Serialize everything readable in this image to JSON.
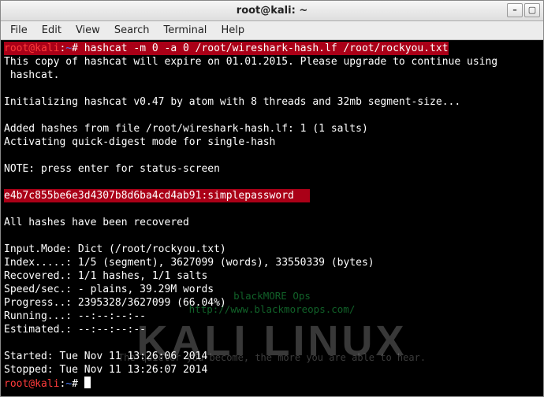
{
  "titlebar": {
    "title": "root@kali: ~",
    "min_icon": "–",
    "max_icon": "▢"
  },
  "menubar": {
    "file": "File",
    "edit": "Edit",
    "view": "View",
    "search": "Search",
    "terminal": "Terminal",
    "help": "Help"
  },
  "prompt": {
    "userhost": "root@kali",
    "colon": ":",
    "path": "~",
    "hash": "#"
  },
  "command": "hashcat -m 0 -a 0 /root/wireshark-hash.lf /root/rockyou.txt",
  "output": {
    "l1": "This copy of hashcat will expire on 01.01.2015. Please upgrade to continue using",
    "l2": " hashcat.",
    "blank_a": "",
    "l3": "Initializing hashcat v0.47 by atom with 8 threads and 32mb segment-size...",
    "blank_b": "",
    "l4": "Added hashes from file /root/wireshark-hash.lf: 1 (1 salts)",
    "l5": "Activating quick-digest mode for single-hash",
    "blank_c": "",
    "l6": "NOTE: press enter for status-screen",
    "blank_d": "",
    "crack": "e4b7c855be6e3d4307b8d6ba4cd4ab91:simplepassword",
    "blank_e": "",
    "l7": "All hashes have been recovered",
    "blank_f": "",
    "l8": "Input.Mode: Dict (/root/rockyou.txt)",
    "l9": "Index.....: 1/5 (segment), 3627099 (words), 33550339 (bytes)",
    "l10": "Recovered.: 1/1 hashes, 1/1 salts",
    "l11": "Speed/sec.: - plains, 39.29M words",
    "l12": "Progress..: 2395328/3627099 (66.04%)",
    "l13": "Running...: --:--:--:--",
    "l14": "Estimated.: --:--:--:--",
    "blank_g": "",
    "l15": "Started: Tue Nov 11 13:26:06 2014",
    "l16": "Stopped: Tue Nov 11 13:26:07 2014"
  },
  "watermark": {
    "ops": "blackMORE Ops",
    "ops_url": "http://www.blackmoreops.com/",
    "kali": "KALI LINUX",
    "tagline": "The quieter you become, the more you are able to hear."
  }
}
